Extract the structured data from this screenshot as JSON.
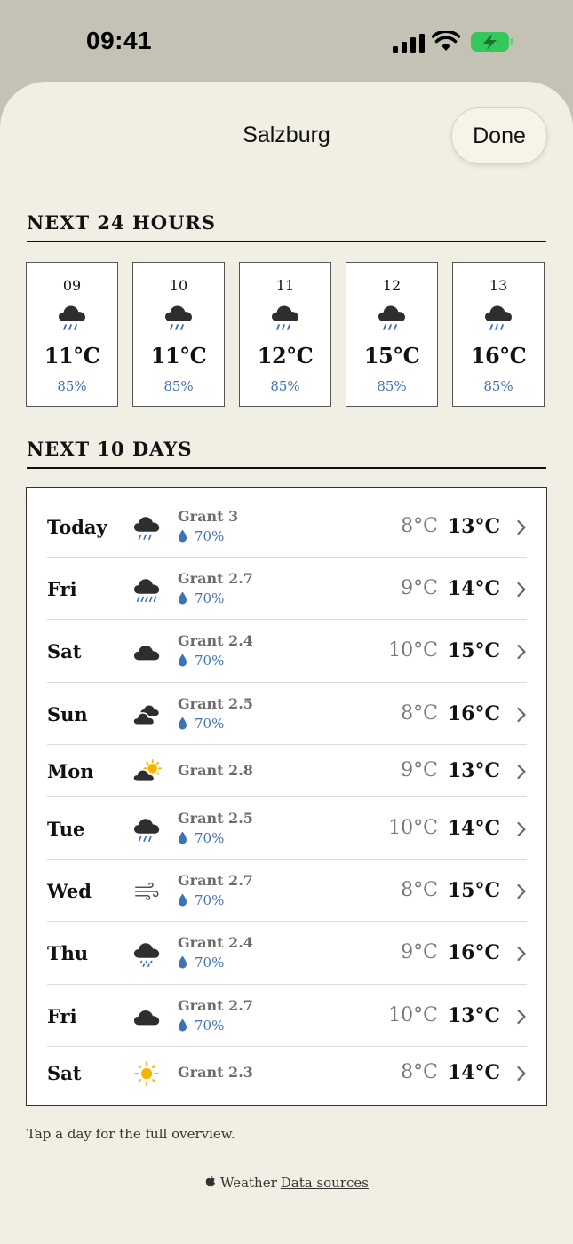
{
  "status_bar": {
    "time": "09:41"
  },
  "header": {
    "title": "Salzburg",
    "done_label": "Done"
  },
  "hourly": {
    "heading": "NEXT 24 HOURS",
    "items": [
      {
        "time": "09",
        "icon": "rain-cloud-icon",
        "temp": "11°C",
        "precip": "85%"
      },
      {
        "time": "10",
        "icon": "rain-cloud-icon",
        "temp": "11°C",
        "precip": "85%"
      },
      {
        "time": "11",
        "icon": "rain-cloud-icon",
        "temp": "12°C",
        "precip": "85%"
      },
      {
        "time": "12",
        "icon": "rain-cloud-icon",
        "temp": "15°C",
        "precip": "85%"
      },
      {
        "time": "13",
        "icon": "rain-cloud-icon",
        "temp": "16°C",
        "precip": "85%"
      }
    ]
  },
  "daily": {
    "heading": "NEXT 10 DAYS",
    "items": [
      {
        "day": "Today",
        "icon": "rain-cloud-icon",
        "grant": "Grant 3",
        "precip": "70%",
        "low": "8°C",
        "high": "13°C"
      },
      {
        "day": "Fri",
        "icon": "heavy-rain-cloud-icon",
        "grant": "Grant 2.7",
        "precip": "70%",
        "low": "9°C",
        "high": "14°C"
      },
      {
        "day": "Sat",
        "icon": "cloud-icon",
        "grant": "Grant 2.4",
        "precip": "70%",
        "low": "10°C",
        "high": "15°C"
      },
      {
        "day": "Sun",
        "icon": "clouds-icon",
        "grant": "Grant 2.5",
        "precip": "70%",
        "low": "8°C",
        "high": "16°C"
      },
      {
        "day": "Mon",
        "icon": "partly-sunny-icon",
        "grant": "Grant 2.8",
        "precip": "",
        "low": "9°C",
        "high": "13°C"
      },
      {
        "day": "Tue",
        "icon": "rain-cloud-icon",
        "grant": "Grant 2.5",
        "precip": "70%",
        "low": "10°C",
        "high": "14°C"
      },
      {
        "day": "Wed",
        "icon": "wind-icon",
        "grant": "Grant 2.7",
        "precip": "70%",
        "low": "8°C",
        "high": "15°C"
      },
      {
        "day": "Thu",
        "icon": "drizzle-cloud-icon",
        "grant": "Grant 2.4",
        "precip": "70%",
        "low": "9°C",
        "high": "16°C"
      },
      {
        "day": "Fri",
        "icon": "cloud-icon",
        "grant": "Grant 2.7",
        "precip": "70%",
        "low": "10°C",
        "high": "13°C"
      },
      {
        "day": "Sat",
        "icon": "sun-icon",
        "grant": "Grant 2.3",
        "precip": "",
        "low": "8°C",
        "high": "14°C"
      }
    ]
  },
  "hint": "Tap a day for the full overview.",
  "footer": {
    "brand": "Weather",
    "link": "Data sources"
  },
  "colors": {
    "sheet": "#f1efe4",
    "background": "#c3c2b4",
    "precip": "#3f72b5",
    "sun": "#f5b400",
    "battery": "#34c759"
  }
}
